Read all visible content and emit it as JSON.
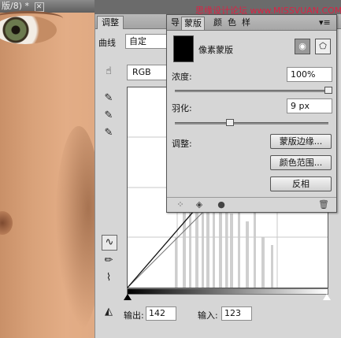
{
  "document": {
    "tab_title": "版/8) *",
    "close_glyph": "✕"
  },
  "watermark": "思缘设计论坛 www.MISSVUAN.COM",
  "adjustments": {
    "tab_label": "调整",
    "curve_label": "曲线",
    "preset_value": "自定",
    "channel": "RGB",
    "output_label": "输出:",
    "output_value": "142",
    "input_label": "输入:",
    "input_value": "123"
  },
  "masks": {
    "tabs": [
      "导",
      "蒙版",
      "颜",
      "色",
      "样"
    ],
    "title": "像素蒙版",
    "density_label": "浓度:",
    "density_value": "100%",
    "density_fraction": 1.0,
    "feather_label": "羽化:",
    "feather_value": "9 px",
    "feather_fraction": 0.36,
    "adjust_label": "调整:",
    "btn_edge": "蒙版边缘...",
    "btn_color_range": "颜色范围...",
    "btn_invert": "反相",
    "menu_glyph": "▾≡"
  },
  "colors": {
    "panel": "#d6d6d6",
    "watermark": "#d24"
  }
}
